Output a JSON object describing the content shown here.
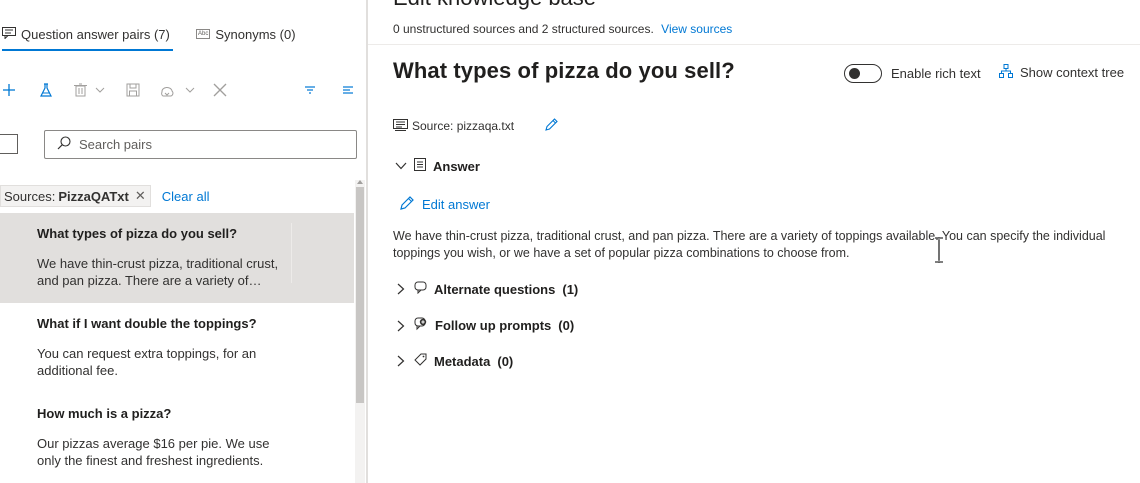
{
  "left": {
    "tabs": [
      {
        "label": "Question answer pairs (7)",
        "icon": "qa-pairs-icon",
        "active": true
      },
      {
        "label": "Synonyms (0)",
        "icon": "synonyms-icon",
        "abbrev": "Abc",
        "active": false
      }
    ],
    "search": {
      "placeholder": "Search pairs"
    },
    "filter": {
      "chip_prefix": "Sources:",
      "chip_value": "PizzaQATxt",
      "clear_label": "Clear all"
    },
    "items": [
      {
        "question": "What types of pizza do you sell?",
        "answer": "We have thin-crust pizza, traditional crust, and pan pizza. There are a variety of…",
        "selected": true
      },
      {
        "question": "What if I want double the toppings?",
        "answer": "You can request extra toppings, for an additional fee.",
        "selected": false
      },
      {
        "question": "How much is a pizza?",
        "answer": "Our pizzas average $16 per pie. We use only the finest and freshest ingredients.",
        "selected": false
      }
    ]
  },
  "right": {
    "page_title": "Edit knowledge base",
    "subtitle": "0 unstructured sources and 2 structured sources.",
    "view_sources_label": "View sources",
    "question_title": "What types of pizza do you sell?",
    "rich_text_label": "Enable rich text",
    "context_tree_label": "Show context tree",
    "source_label": "Source: pizzaqa.txt",
    "answer_section": "Answer",
    "edit_answer_label": "Edit answer",
    "answer_text": "We have thin-crust pizza, traditional crust, and pan pizza. There are a variety of toppings available. You can specify the individual toppings you wish, or we have a set of popular pizza combinations to choose from.",
    "sections": [
      {
        "label": "Alternate questions",
        "count": "(1)"
      },
      {
        "label": "Follow up prompts",
        "count": "(0)"
      },
      {
        "label": "Metadata",
        "count": "(0)"
      }
    ]
  },
  "colors": {
    "accent": "#0078d4",
    "selected_row": "#e1dfdd",
    "text": "#323130"
  }
}
